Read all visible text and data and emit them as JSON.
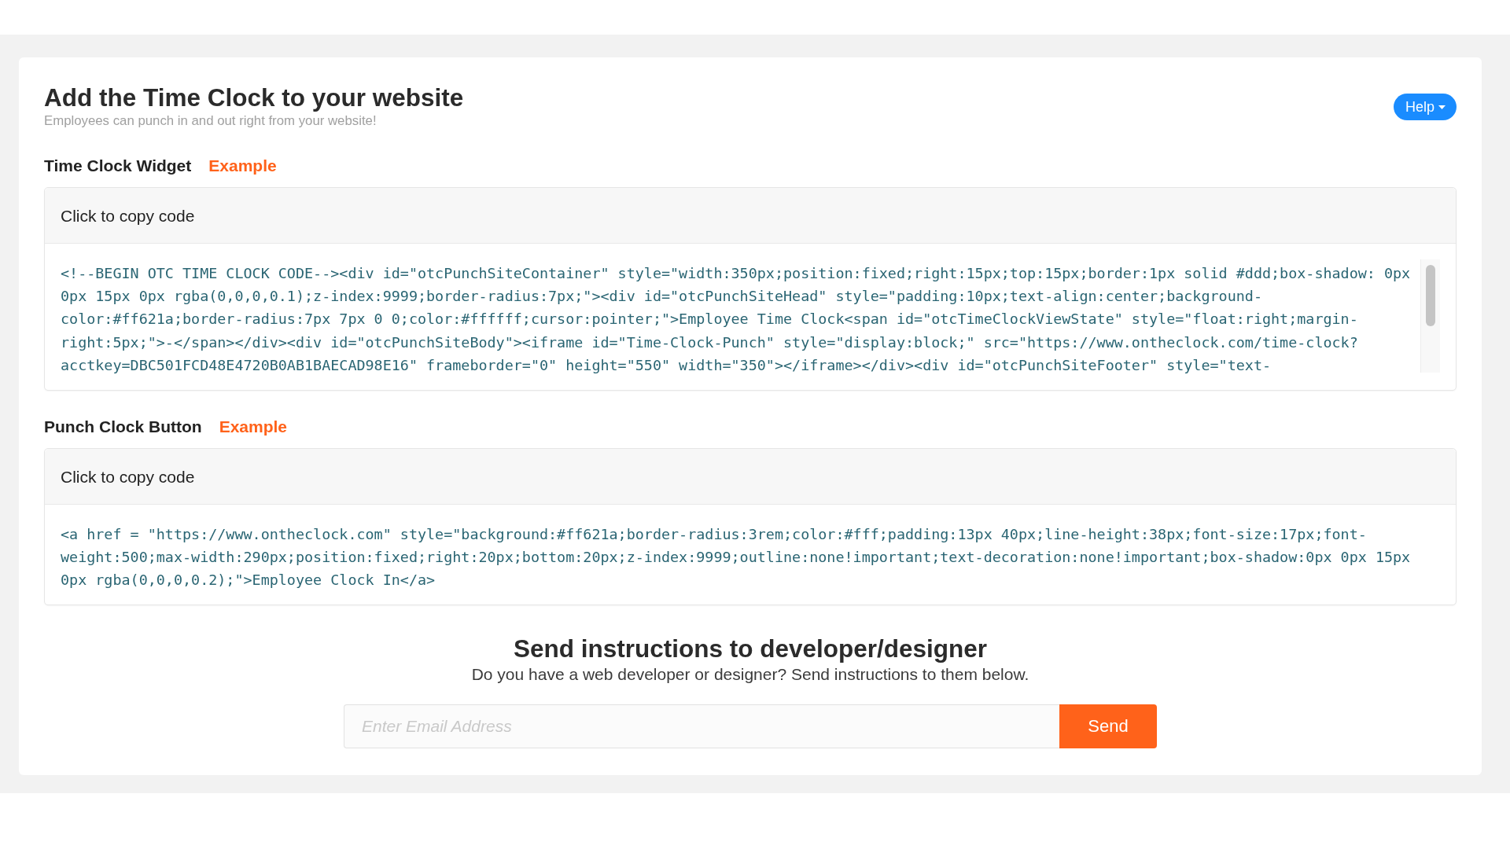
{
  "header": {
    "title": "Add the Time Clock to your website",
    "subtitle": "Employees can punch in and out right from your website!",
    "help_button": "Help"
  },
  "sections": [
    {
      "label": "Time Clock Widget",
      "example_link": "Example",
      "copy_label": "Click to copy code",
      "code": "<!--BEGIN OTC TIME CLOCK CODE--><div id=\"otcPunchSiteContainer\" style=\"width:350px;position:fixed;right:15px;top:15px;border:1px solid #ddd;box-shadow: 0px 0px 15px 0px rgba(0,0,0,0.1);z-index:9999;border-radius:7px;\"><div id=\"otcPunchSiteHead\" style=\"padding:10px;text-align:center;background-color:#ff621a;border-radius:7px 7px 0 0;color:#ffffff;cursor:pointer;\">Employee Time Clock<span id=\"otcTimeClockViewState\" style=\"float:right;margin-right:5px;\">-</span></div><div id=\"otcPunchSiteBody\"><iframe id=\"Time-Clock-Punch\" style=\"display:block;\" src=\"https://www.ontheclock.com/time-clock?acctkey=DBC501FCD48E4720B0AB1BAECAD98E16\" frameborder=\"0\" height=\"550\" width=\"350\"></iframe></div><div id=\"otcPunchSiteFooter\" style=\"text-",
      "has_scrollbar": true
    },
    {
      "label": "Punch Clock Button",
      "example_link": "Example",
      "copy_label": "Click to copy code",
      "code": "<a href = \"https://www.ontheclock.com\" style=\"background:#ff621a;border-radius:3rem;color:#fff;padding:13px 40px;line-height:38px;font-size:17px;font-weight:500;max-width:290px;position:fixed;right:20px;bottom:20px;z-index:9999;outline:none!important;text-decoration:none!important;box-shadow:0px 0px 15px 0px rgba(0,0,0,0.2);\">Employee Clock In</a>",
      "has_scrollbar": false
    }
  ],
  "send_instructions": {
    "title": "Send instructions to developer/designer",
    "text": "Do you have a web developer or designer? Send instructions to them below.",
    "email_field": {
      "placeholder": "Enter Email Address"
    },
    "send_button": "Send"
  }
}
